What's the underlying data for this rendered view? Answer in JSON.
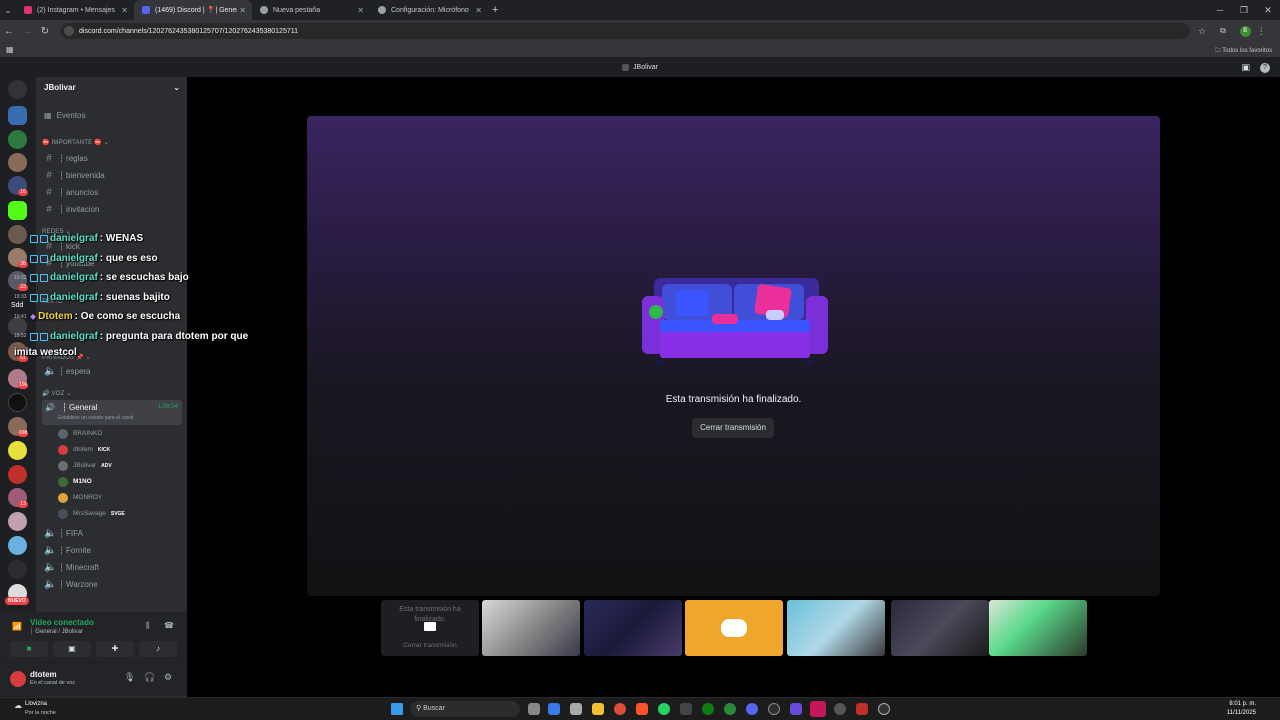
{
  "browser": {
    "tabs": [
      {
        "label": "(2) Instagram • Mensajes",
        "color": "#e1306c"
      },
      {
        "label": "(1469) Discord | 📍| Genera",
        "color": "#5865f2"
      },
      {
        "label": "Nueva pestaña",
        "color": "#9aa0a6"
      },
      {
        "label": "Configuración: Micrófono",
        "color": "#9aa0a6"
      }
    ],
    "url": "discord.com/channels/1202762435380125707/1202762435380125711",
    "bookmarks_label": "Todos los favoritos",
    "profile_initial": "B"
  },
  "discord": {
    "title_bar": "JBolivar",
    "server_name": "JBolivar",
    "events_label": "Eventos",
    "categories": {
      "importante": "IMPORTANTE",
      "redes": "REDES",
      "texto": "TEXTO",
      "privados": "PRIVADOS",
      "voz": "VOZ"
    },
    "channels": {
      "reglas": "┆ reglas",
      "bienvenida": "┆ bienvenida",
      "anuncios": "┆ anuncios",
      "invitacion": "┆ invitacion",
      "kick": "┆ kick",
      "youtube": "┆ youtube",
      "espera": "┆ espera",
      "general": "┆ General",
      "general_time": "1:08:54",
      "general_status": "Establece un estado para el canal",
      "fifa": "┆ FIFA",
      "fornite": "┆ Fornite",
      "minecraft": "┆ Minecraft",
      "warzone": "┆ Warzone"
    },
    "voice_users": [
      {
        "name": "BRAINKO",
        "tag": "",
        "color": "#5b6270"
      },
      {
        "name": "dtotem",
        "tag": "KICK",
        "color": "#d83c3e"
      },
      {
        "name": "JBolivar",
        "tag": "ADV",
        "color": "#6b6f7a"
      },
      {
        "name": "M1NO",
        "tag": "",
        "color": "#3f6b3a"
      },
      {
        "name": "MONROY",
        "tag": "",
        "color": "#e0a43a"
      },
      {
        "name": "MrsSavage",
        "tag": "SVGE",
        "color": "#4a4e5a"
      }
    ],
    "guild_badges": [
      "16",
      "38",
      "23",
      "61",
      "196",
      "698",
      "13"
    ],
    "new_badge": "NUEVO",
    "stream_ended": "Esta transmisión ha finalizado.",
    "close_stream": "Cerrar transmisión",
    "thumb_ended_text": "Esta transmisión ha finalizado.",
    "thumb_close": "Cerrar transmisión",
    "voice_connected": "Video conectado",
    "voice_location": "┆ General / JBolivar",
    "current_user": "dtotem",
    "current_user_status": "En el canal de voz"
  },
  "chat_overlay": [
    {
      "user": "danielgraf",
      "text": ": WENAS"
    },
    {
      "user": "danielgraf",
      "text": ": que es eso"
    },
    {
      "user": "danielgraf",
      "text": ": se escuchas bajo"
    },
    {
      "user": "danielgraf",
      "text": ": suenas bajito"
    },
    {
      "user": "Dtotem",
      "text": ": Oe como se escucha"
    },
    {
      "user": "danielgraf",
      "text": ": pregunta para dtotem por que"
    },
    {
      "user": "",
      "text": "imita westcol"
    }
  ],
  "chat_timestamps": [
    "19:32",
    "19:33",
    "19:41",
    "19:52"
  ],
  "chat_misc": "Sdd",
  "taskbar": {
    "weather": "Llovizna",
    "weather_sub": "Por la noche",
    "search": "Buscar",
    "time": "8:01 p. m.",
    "date": "11/11/2025"
  }
}
